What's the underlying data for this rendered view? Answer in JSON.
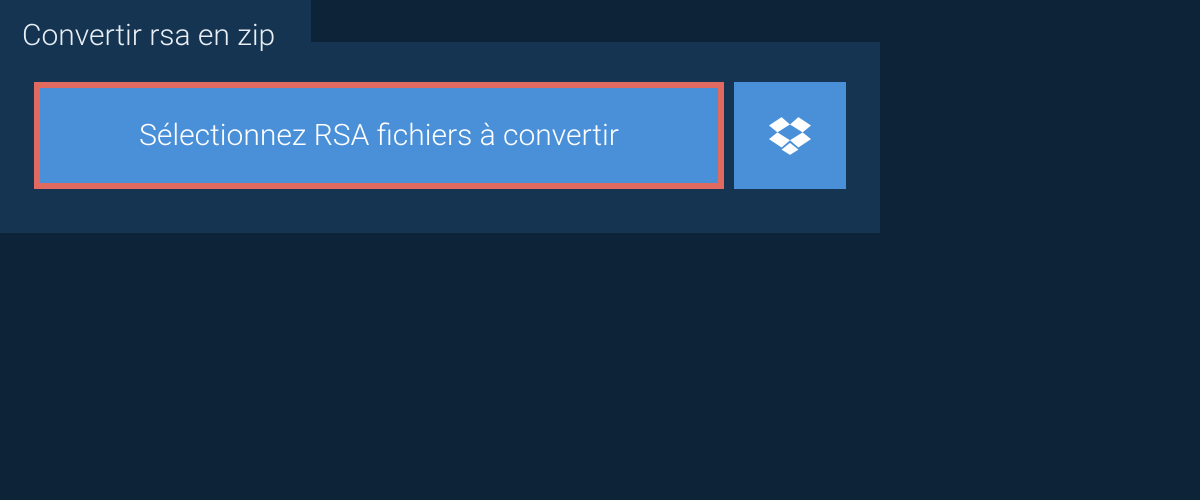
{
  "tab": {
    "title": "Convertir rsa en zip"
  },
  "actions": {
    "select_files_label": "Sélectionnez RSA fichiers à convertir"
  },
  "colors": {
    "background": "#0d2438",
    "panel": "#143451",
    "button": "#4a90d9",
    "highlight_border": "#e06a5f",
    "text_light": "#ffffff"
  }
}
